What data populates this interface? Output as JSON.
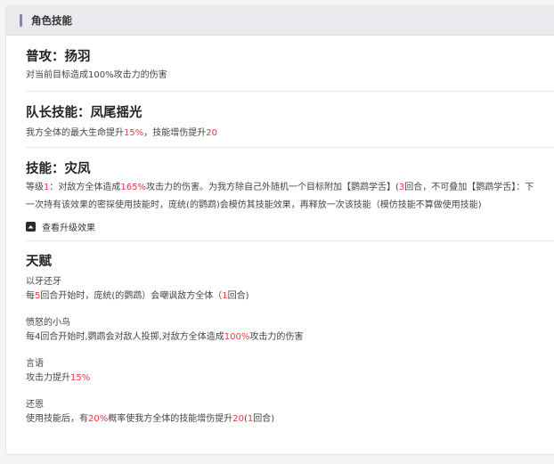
{
  "header": {
    "title": "角色技能"
  },
  "normal_attack": {
    "title": "普攻：扬羽",
    "desc": "对当前目标造成100%攻击力的伤害"
  },
  "leader_skill": {
    "title": "队长技能：凤尾摇光",
    "desc_parts": [
      "我方全体的最大生命提升",
      "15%",
      "，技能增伤提升",
      "20"
    ]
  },
  "skill": {
    "title": "技能：灾凤",
    "line1_parts": [
      "等级",
      "1",
      "：对敌方全体造成",
      "165%",
      "攻击力的伤害。为我方除自己外随机一个目标附加【鹦鹉学舌】(",
      "3",
      "回合，不可叠加【鹦鹉学舌】：下"
    ],
    "line2": "一次持有该效果的密探使用技能时，庞统(的鹦鹉)会模仿其技能效果，再释放一次该技能（模仿技能不算做使用技能)",
    "expand_label": "查看升级效果"
  },
  "talent": {
    "title": "天赋",
    "items": [
      {
        "name": "以牙还牙",
        "desc_parts": [
          "每",
          "5",
          "回合开始时，庞统(的鹦鹉）会嘲讽敌方全体（",
          "1",
          "回合)"
        ]
      },
      {
        "name": "愤怒的小鸟",
        "desc_parts": [
          "每4回合开始时,鹦鹉会对敌人投掷,对敌方全体造成",
          "100%",
          "攻击力的伤害"
        ]
      },
      {
        "name": "言语",
        "desc_parts": [
          "攻击力提升",
          "15%"
        ]
      },
      {
        "name": "还恩",
        "desc_parts": [
          "使用技能后，有",
          "20%",
          "概率使我方全体的技能增伤提升",
          "20",
          "(",
          "1",
          "回合)"
        ]
      }
    ]
  },
  "colors": {
    "accent_red": "#e8383d",
    "header_bar": "#7f86a8"
  }
}
